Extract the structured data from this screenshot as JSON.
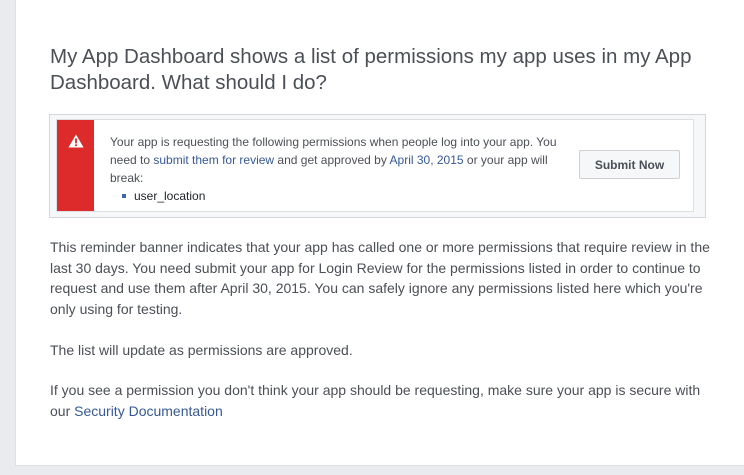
{
  "faq": {
    "question": "My App Dashboard shows a list of permissions my app uses in my App Dashboard. What should I do?"
  },
  "banner": {
    "text_before_link": "Your app is requesting the following permissions when people log into your app. You need to ",
    "review_link": "submit them for review",
    "text_middle": " and get approved by ",
    "deadline_link": "April 30, 2015",
    "text_after": " or your app will break:",
    "permissions": [
      "user_location"
    ],
    "button_label": "Submit Now",
    "icon": "warning-triangle-icon",
    "accent_color": "#dd2a2a"
  },
  "body": {
    "paragraph_1": "This reminder banner indicates that your app has called one or more permissions that require review in the last 30 days. You need submit your app for Login Review for the permissions listed in order to continue to request and use them after April 30, 2015. You can safely ignore any permissions listed here which you're only using for testing.",
    "paragraph_2": "The list will update as permissions are approved.",
    "paragraph_3_text": "If you see a permission you don't think your app should be requesting, make sure your app is secure with our ",
    "security_link": "Security Documentation"
  },
  "colors": {
    "link": "#365899",
    "text": "#4b4f56"
  }
}
